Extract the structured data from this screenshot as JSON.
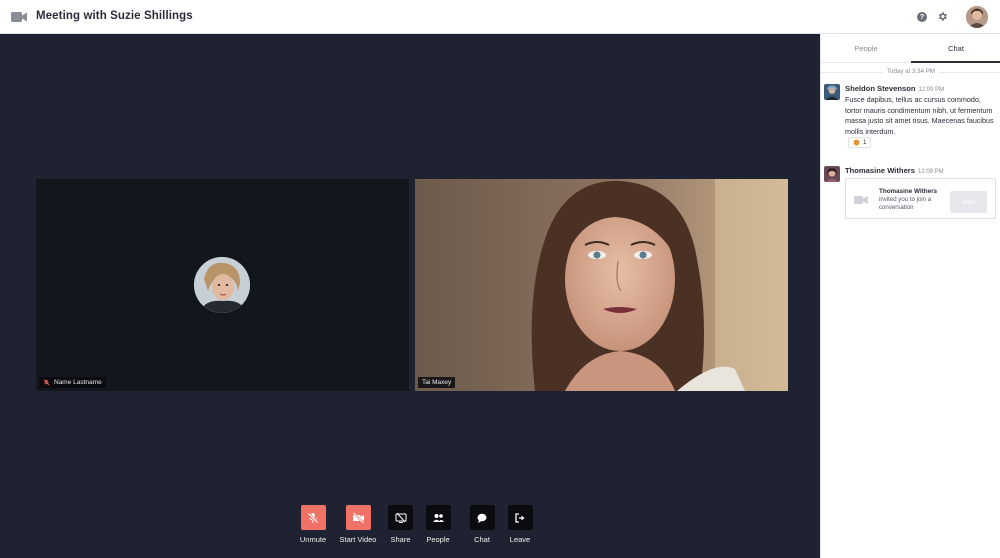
{
  "header": {
    "title": "Meeting with Suzie Shillings",
    "help_glyph": "?"
  },
  "stage": {
    "tiles": [
      {
        "name": "Name Lastname",
        "muted": true
      },
      {
        "name": "Tai Maxey",
        "muted": false
      }
    ]
  },
  "controls": [
    {
      "label": "Unmute",
      "icon": "mic-off-icon",
      "color": "#f07166"
    },
    {
      "label": "Start Video",
      "icon": "video-off-icon",
      "color": "#f07166"
    },
    {
      "label": "Share",
      "icon": "share-screen-icon",
      "color": "#0b0c10"
    },
    {
      "label": "People",
      "icon": "people-icon",
      "color": "#0b0c10"
    },
    {
      "label": "Chat",
      "icon": "chat-bubble-icon",
      "color": "#0b0c10"
    },
    {
      "label": "Leave",
      "icon": "leave-icon",
      "color": "#0b0c10"
    }
  ],
  "sidebar": {
    "tabs": [
      {
        "label": "People",
        "active": false
      },
      {
        "label": "Chat",
        "active": true
      }
    ],
    "day_separator": "Today at 3:34 PM",
    "messages": [
      {
        "author": "Sheldon Stevenson",
        "time": "12:09 PM",
        "text": "Fusce dapibus, tellus ac cursus commodo, tortor mauris condimentum nibh, ut fermentum massa justo sit amet risus. Maecenas faucibus mollis interdum.",
        "reaction_count": "1"
      },
      {
        "author": "Thomasine Withers",
        "time": "12:09 PM",
        "invite": {
          "title": "Thomasine Withers",
          "text": "invited you to join a conversation",
          "button": "Join"
        }
      }
    ]
  }
}
